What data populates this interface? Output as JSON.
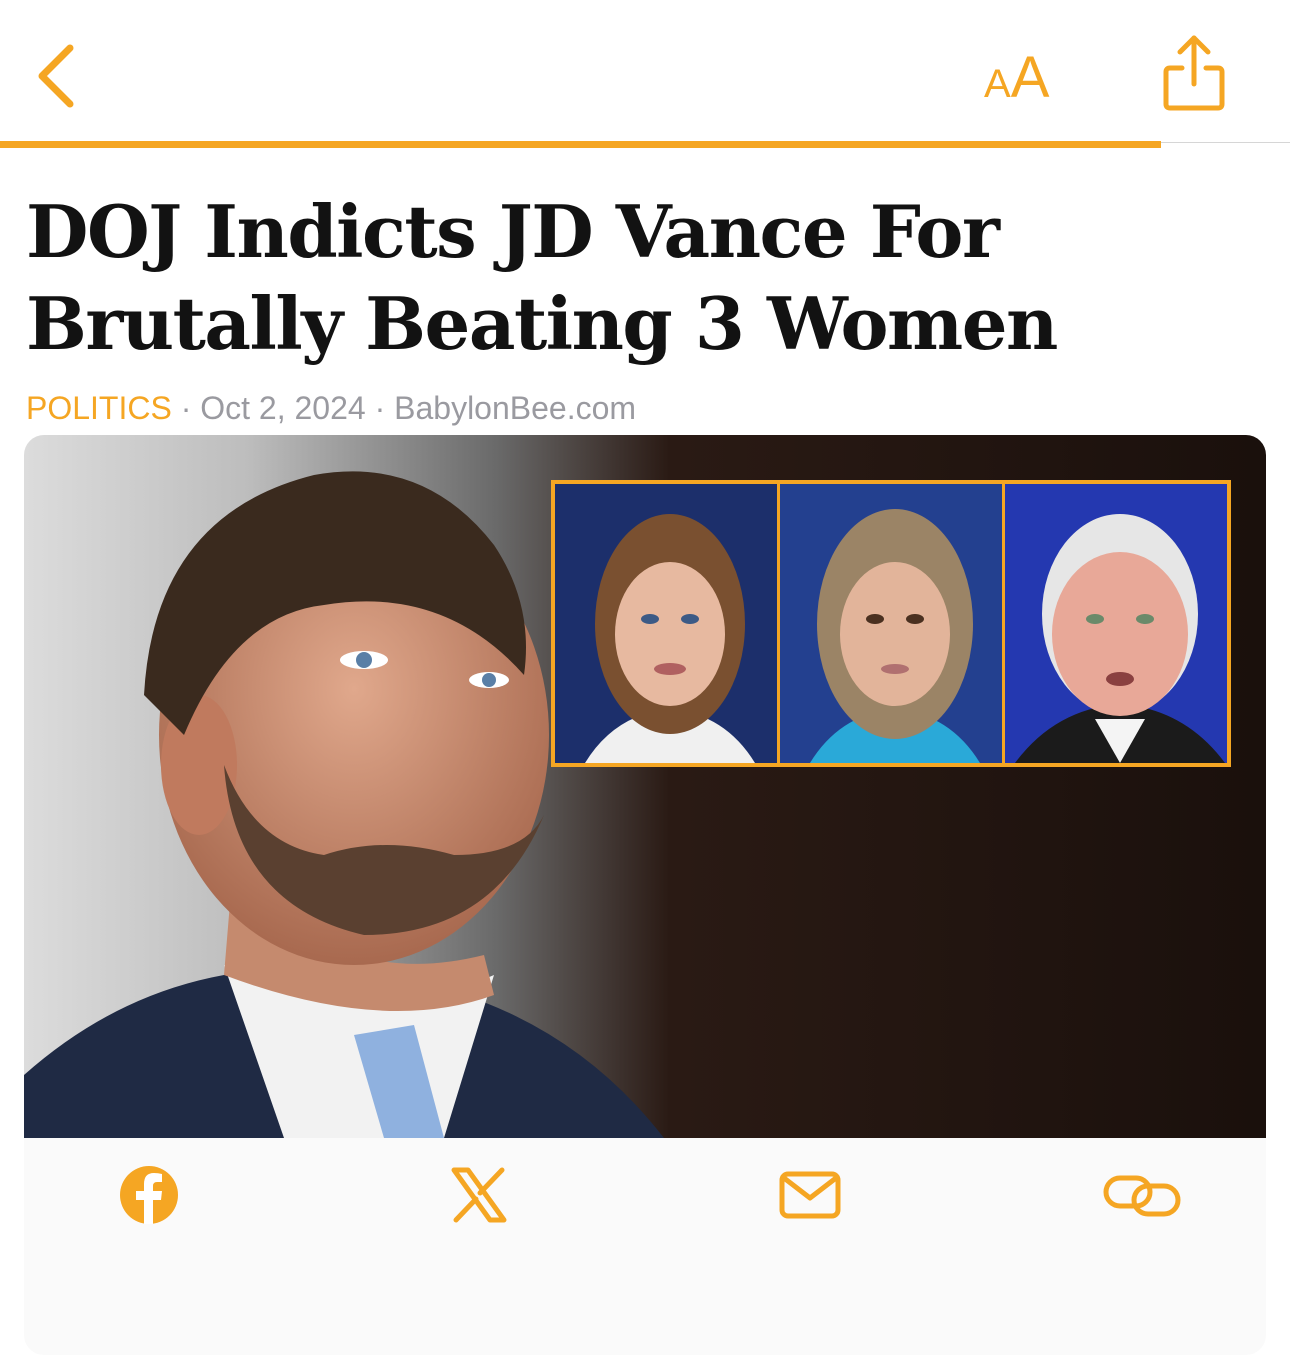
{
  "nav": {
    "back_icon": "chevron-left-icon",
    "text_size_small": "A",
    "text_size_large": "A",
    "share_icon": "share-icon",
    "reading_progress": 0.9
  },
  "article": {
    "title": "DOJ Indicts JD Vance For Brutally Beating 3 Women",
    "category": "POLITICS",
    "separator": "·",
    "date": "Oct 2, 2024",
    "source": "BabylonBee.com"
  },
  "share_bar": {
    "icons": [
      "facebook-icon",
      "x-icon",
      "mail-icon",
      "link-icon"
    ]
  },
  "colors": {
    "accent": "#f5a623",
    "title": "#121212",
    "meta": "#9a9aa0"
  }
}
